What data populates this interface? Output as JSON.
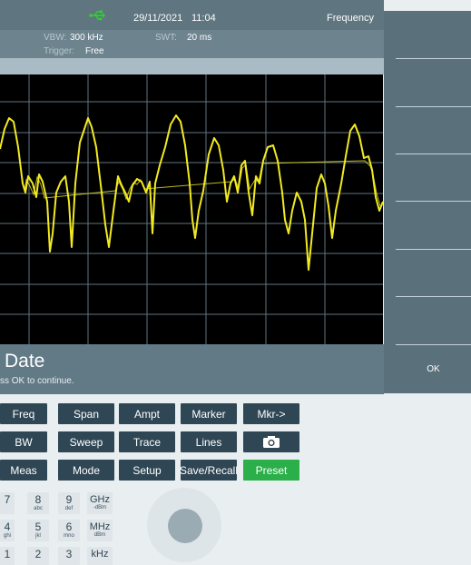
{
  "status": {
    "usb_icon": "usb-icon",
    "date": "29/11/2021",
    "time": "11:04",
    "mode": "Frequency"
  },
  "params": {
    "vbw_label": "VBW:",
    "vbw_value": "300 kHz",
    "swt_label": "SWT:",
    "swt_value": "20 ms",
    "trigger_label": "Trigger:",
    "trigger_value": "Free"
  },
  "message": {
    "title": "Date",
    "subtitle": "ss OK to continue."
  },
  "softkeys": {
    "ok_label": "OK"
  },
  "keypad": {
    "row1": [
      "Freq",
      "Span",
      "Ampt",
      "Marker",
      "Mkr->"
    ],
    "row2": [
      "BW",
      "Sweep",
      "Trace",
      "Lines",
      "camera-icon"
    ],
    "row3": [
      "Meas",
      "Mode",
      "Setup",
      "Save/Recall",
      "Preset"
    ],
    "numbers": [
      {
        "main": "7",
        "sub": ""
      },
      {
        "main": "8",
        "sub": "abc"
      },
      {
        "main": "9",
        "sub": "def"
      },
      {
        "main": "4",
        "sub": "ghi"
      },
      {
        "main": "5",
        "sub": "jkl"
      },
      {
        "main": "6",
        "sub": "mno"
      },
      {
        "main": "1",
        "sub": ""
      },
      {
        "main": "2",
        "sub": ""
      },
      {
        "main": "3",
        "sub": ""
      }
    ],
    "units": [
      {
        "main": "GHz",
        "sub": "-dBm"
      },
      {
        "main": "MHz",
        "sub": "dBm"
      },
      {
        "main": "kHz",
        "sub": ""
      }
    ]
  },
  "colors": {
    "trace": "#f2ea20",
    "preset": "#2aaf49",
    "key": "#2f4654"
  }
}
